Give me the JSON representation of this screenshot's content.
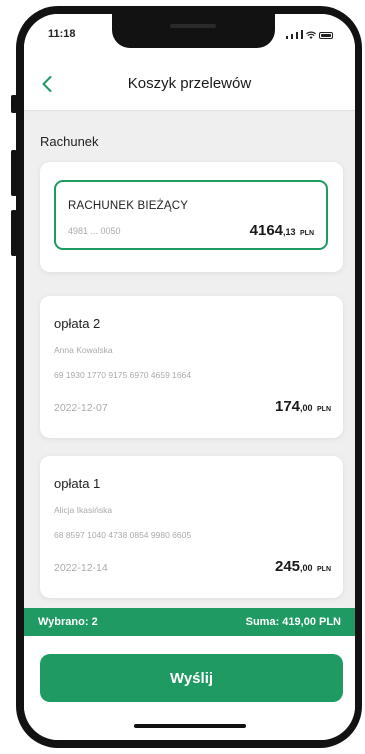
{
  "status_bar": {
    "time": "11:18"
  },
  "header": {
    "title": "Koszyk przelewów",
    "back_icon": "chevron-left-icon"
  },
  "section": {
    "label": "Rachunek"
  },
  "account": {
    "name": "RACHUNEK BIEŻĄCY",
    "number": "4981 ... 0050",
    "amount_major": "4164",
    "amount_minor": ",13",
    "currency": "PLN"
  },
  "transfers": [
    {
      "name": "opłata 2",
      "recipient": "Anna Kowalska",
      "account": "69 1930 1770 9175 6970 4659 1664",
      "date": "2022-12-07",
      "amount_major": "174",
      "amount_minor": ",00",
      "currency": "PLN"
    },
    {
      "name": "opłata 1",
      "recipient": "Alicja Ikasińska",
      "account": "68 8597 1040 4738 0854 9980 6605",
      "date": "2022-12-14",
      "amount_major": "245",
      "amount_minor": ",00",
      "currency": "PLN"
    }
  ],
  "summary": {
    "selected": "Wybrano: 2",
    "total": "Suma: 419,00 PLN"
  },
  "actions": {
    "send_label": "Wyślij"
  },
  "colors": {
    "accent": "#1f9a63",
    "background": "#efefef",
    "card": "#ffffff"
  }
}
